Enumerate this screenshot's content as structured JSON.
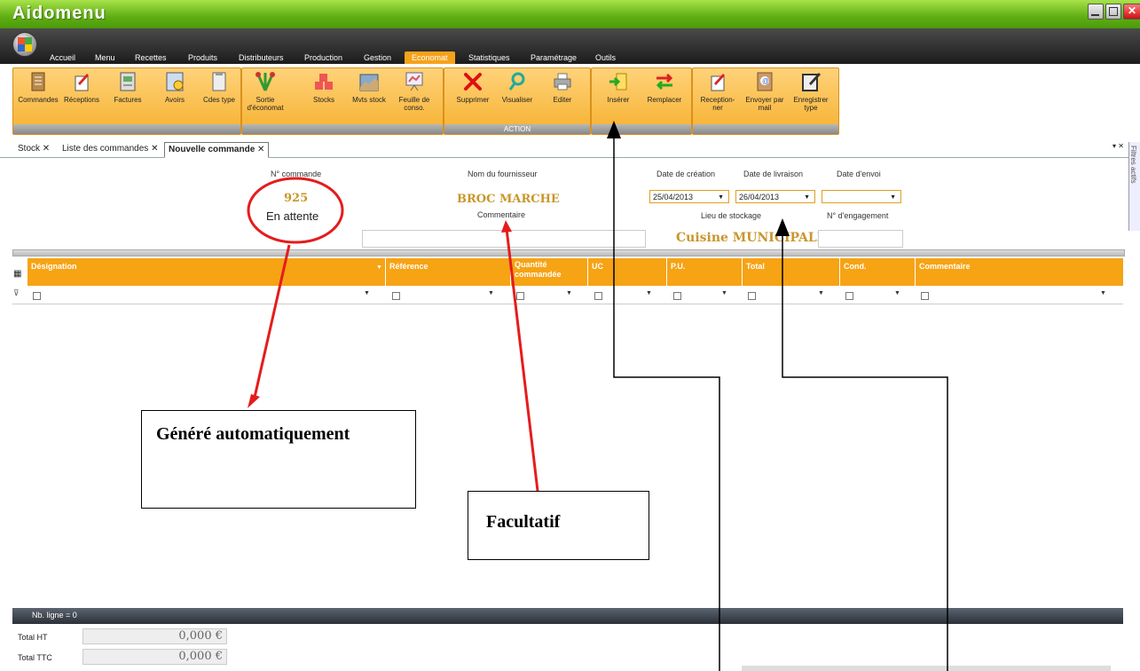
{
  "app": {
    "title": "Aidomenu"
  },
  "menu": {
    "tabs": [
      "Accueil",
      "Menu",
      "Recettes",
      "Produits",
      "Distributeurs",
      "Production",
      "Gestion",
      "Economat",
      "Statistiques",
      "Paramétrage",
      "Outils"
    ],
    "active": "Economat"
  },
  "ribbon": {
    "buttons": [
      {
        "label": "Commandes",
        "icon": "orders-icon"
      },
      {
        "label": "Réceptions",
        "icon": "receptions-icon"
      },
      {
        "label": "Factures",
        "icon": "invoices-icon"
      },
      {
        "label": "Avoirs",
        "icon": "credit-notes-icon"
      },
      {
        "label": "Cdes type",
        "icon": "order-templates-icon"
      },
      {
        "label": "Sortie d'économat",
        "icon": "stock-exit-icon"
      },
      {
        "label": "Stocks",
        "icon": "stocks-icon"
      },
      {
        "label": "Mvts stock",
        "icon": "stock-movements-icon"
      },
      {
        "label": "Feuille de conso.",
        "icon": "consumption-sheet-icon"
      },
      {
        "label": "Supprimer",
        "icon": "delete-icon"
      },
      {
        "label": "Visualiser",
        "icon": "view-icon"
      },
      {
        "label": "Editer",
        "icon": "print-icon"
      },
      {
        "label": "Insérer",
        "icon": "insert-icon"
      },
      {
        "label": "Remplacer",
        "icon": "replace-icon"
      },
      {
        "label": "Reception- ner",
        "icon": "receive-icon"
      },
      {
        "label": "Envoyer par mail",
        "icon": "send-mail-icon"
      },
      {
        "label": "Enregistrer type",
        "icon": "save-template-icon"
      }
    ],
    "action_group": "ACTION"
  },
  "doctabs": [
    {
      "label": "Stock",
      "active": false
    },
    {
      "label": "Liste des commandes",
      "active": false
    },
    {
      "label": "Nouvelle commande",
      "active": true
    }
  ],
  "side_panel": {
    "label": "Filtres actifs"
  },
  "form": {
    "order_number_label": "N° commande",
    "order_number": "925",
    "status": "En attente",
    "supplier_label": "Nom du fournisseur",
    "supplier": "BROC MARCHE",
    "comment_label": "Commentaire",
    "creation_date_label": "Date de création",
    "creation_date": "25/04/2013",
    "delivery_date_label": "Date de livraison",
    "delivery_date": "26/04/2013",
    "send_date_label": "Date d'envoi",
    "send_date": "",
    "storage_label": "Lieu de stockage",
    "storage": "Cuisine MUNICIPALE",
    "engagement_label": "N° d'engagement"
  },
  "grid": {
    "columns": [
      "Désignation",
      "Référence",
      "Quantité commandée",
      "UC",
      "P.U.",
      "Total",
      "Cond.",
      "Commentaire"
    ]
  },
  "footer": {
    "line_count": "Nb. ligne = 0",
    "total_ht_label": "Total HT",
    "total_ht": "0,000 €",
    "total_ttc_label": "Total TTC",
    "total_ttc": "0,000 €"
  },
  "annotations": {
    "generated": "Généré automatiquement",
    "optional": "Facultatif"
  },
  "colors": {
    "accent": "#f6a314",
    "title_green": "#5fae12",
    "annotation_red": "#e51c1c"
  }
}
